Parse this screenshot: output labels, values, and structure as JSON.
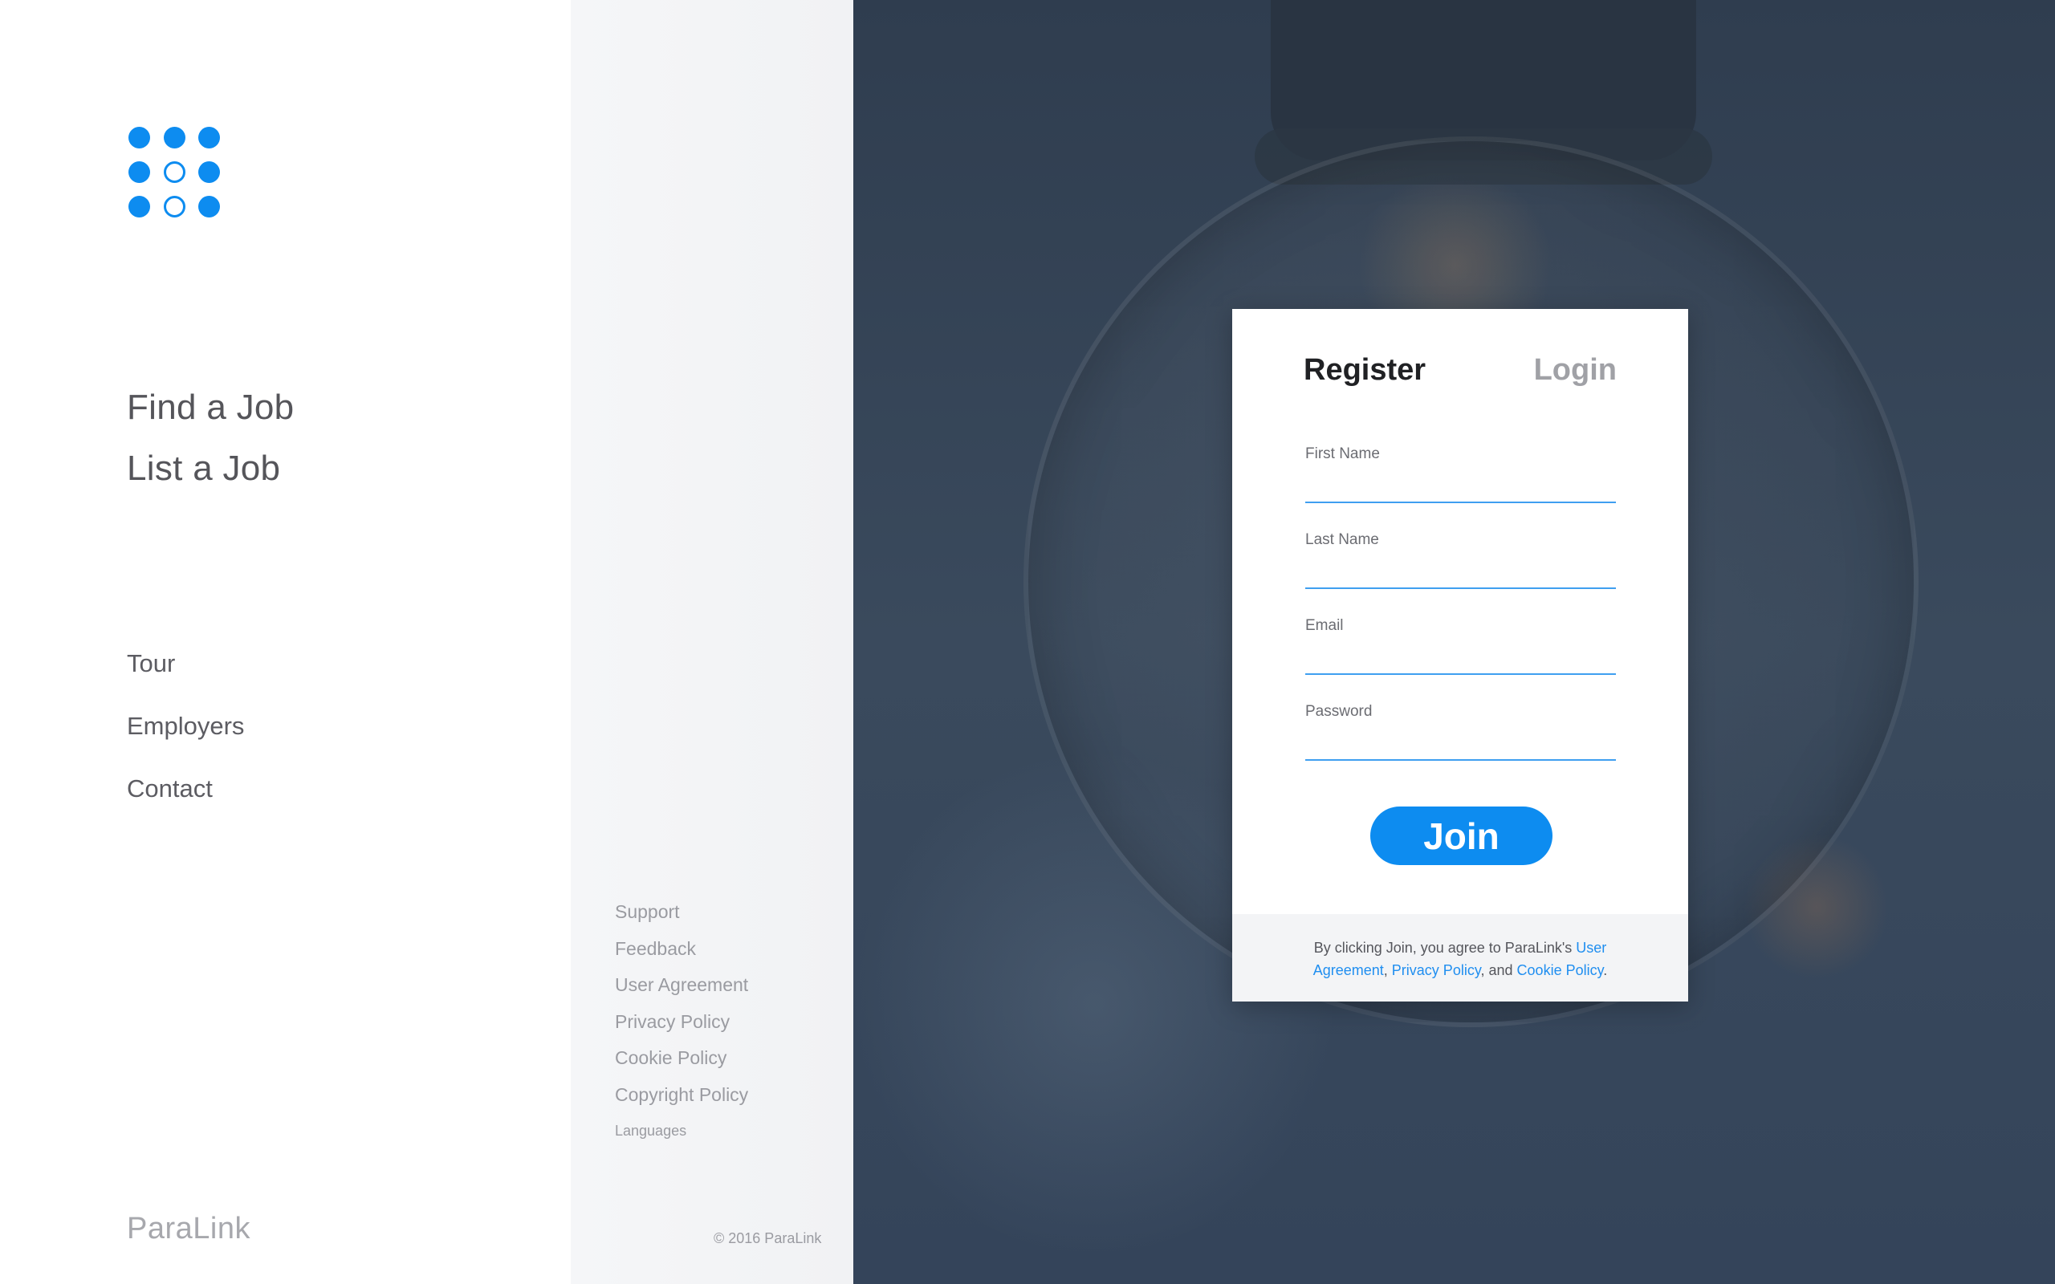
{
  "sidebar": {
    "primary_nav": [
      {
        "label": "Find a Job"
      },
      {
        "label": "List a Job"
      }
    ],
    "secondary_nav": [
      {
        "label": "Tour"
      },
      {
        "label": "Employers"
      },
      {
        "label": "Contact"
      }
    ],
    "brand": "ParaLink"
  },
  "footer": {
    "links": [
      {
        "label": "Support"
      },
      {
        "label": "Feedback"
      },
      {
        "label": "User Agreement"
      },
      {
        "label": "Privacy Policy"
      },
      {
        "label": "Cookie Policy"
      },
      {
        "label": "Copyright Policy"
      }
    ],
    "languages": "Languages",
    "copyright": "© 2016 ParaLink"
  },
  "form": {
    "tab_register": "Register",
    "tab_login": "Login",
    "fields": {
      "first_name": {
        "label": "First Name",
        "value": ""
      },
      "last_name": {
        "label": "Last Name",
        "value": ""
      },
      "email": {
        "label": "Email",
        "value": ""
      },
      "password": {
        "label": "Password",
        "value": ""
      }
    },
    "join_label": "Join",
    "legal": {
      "prefix": "By clicking Join, you agree to ParaLink's ",
      "user_agreement": "User Agreement",
      "sep1": ", ",
      "privacy_policy": "Privacy Policy",
      "sep2": ", and ",
      "cookie_policy": "Cookie Policy",
      "suffix": "."
    }
  },
  "colors": {
    "accent": "#0d8cf0",
    "hero_bg": "#36465a",
    "link": "#1f8ef0"
  },
  "icons": {
    "logo": "dot-grid-logo-icon"
  }
}
